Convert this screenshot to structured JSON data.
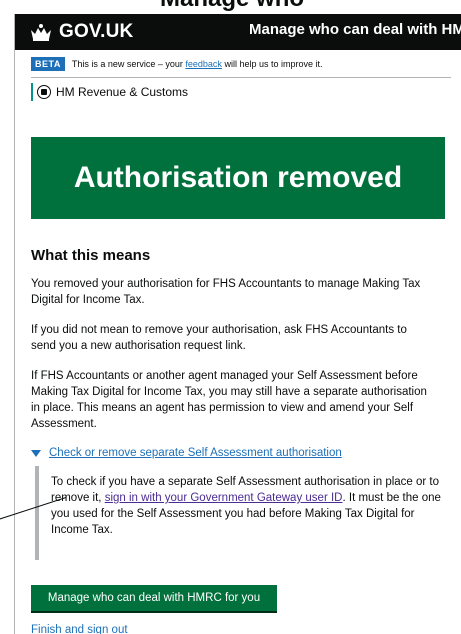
{
  "top_fragment": "Manage who can deal with HMRC for you",
  "header": {
    "logo_text": "GOV.UK",
    "service_name": "Manage who can deal with HM"
  },
  "phase_banner": {
    "tag": "BETA",
    "text_before": "This is a new service – your",
    "link": "feedback",
    "text_after": "will help us to improve it."
  },
  "organisation": "HM Revenue & Customs",
  "panel_title": "Authorisation removed",
  "section_heading": "What this means",
  "paragraphs": [
    "You removed your authorisation for FHS Accountants to manage Making Tax Digital for Income Tax.",
    "If you did not mean to remove your authorisation, ask FHS Accountants to send you a new authorisation request link.",
    "If FHS Accountants or another agent managed your Self Assessment before Making Tax Digital for Income Tax, you may still have a separate authorisation in place. This means an agent has permission to view and amend your Self Assessment."
  ],
  "details": {
    "summary": "Check or remove separate Self Assessment authorisation",
    "text_before": "To check if you have a separate Self Assessment authorisation in place or to remove it,",
    "link": "sign in with your Government Gateway user ID",
    "text_after": ". It must be the one you used for the Self Assessment you had before Making Tax Digital for Income Tax."
  },
  "primary_button": "Manage who can deal with HMRC for you",
  "finish_link": "Finish and sign out",
  "colors": {
    "header": "#0b0c0c",
    "accent_green": "#00703c",
    "link_blue": "#1d70b8",
    "visited_purple": "#4c2c92"
  }
}
